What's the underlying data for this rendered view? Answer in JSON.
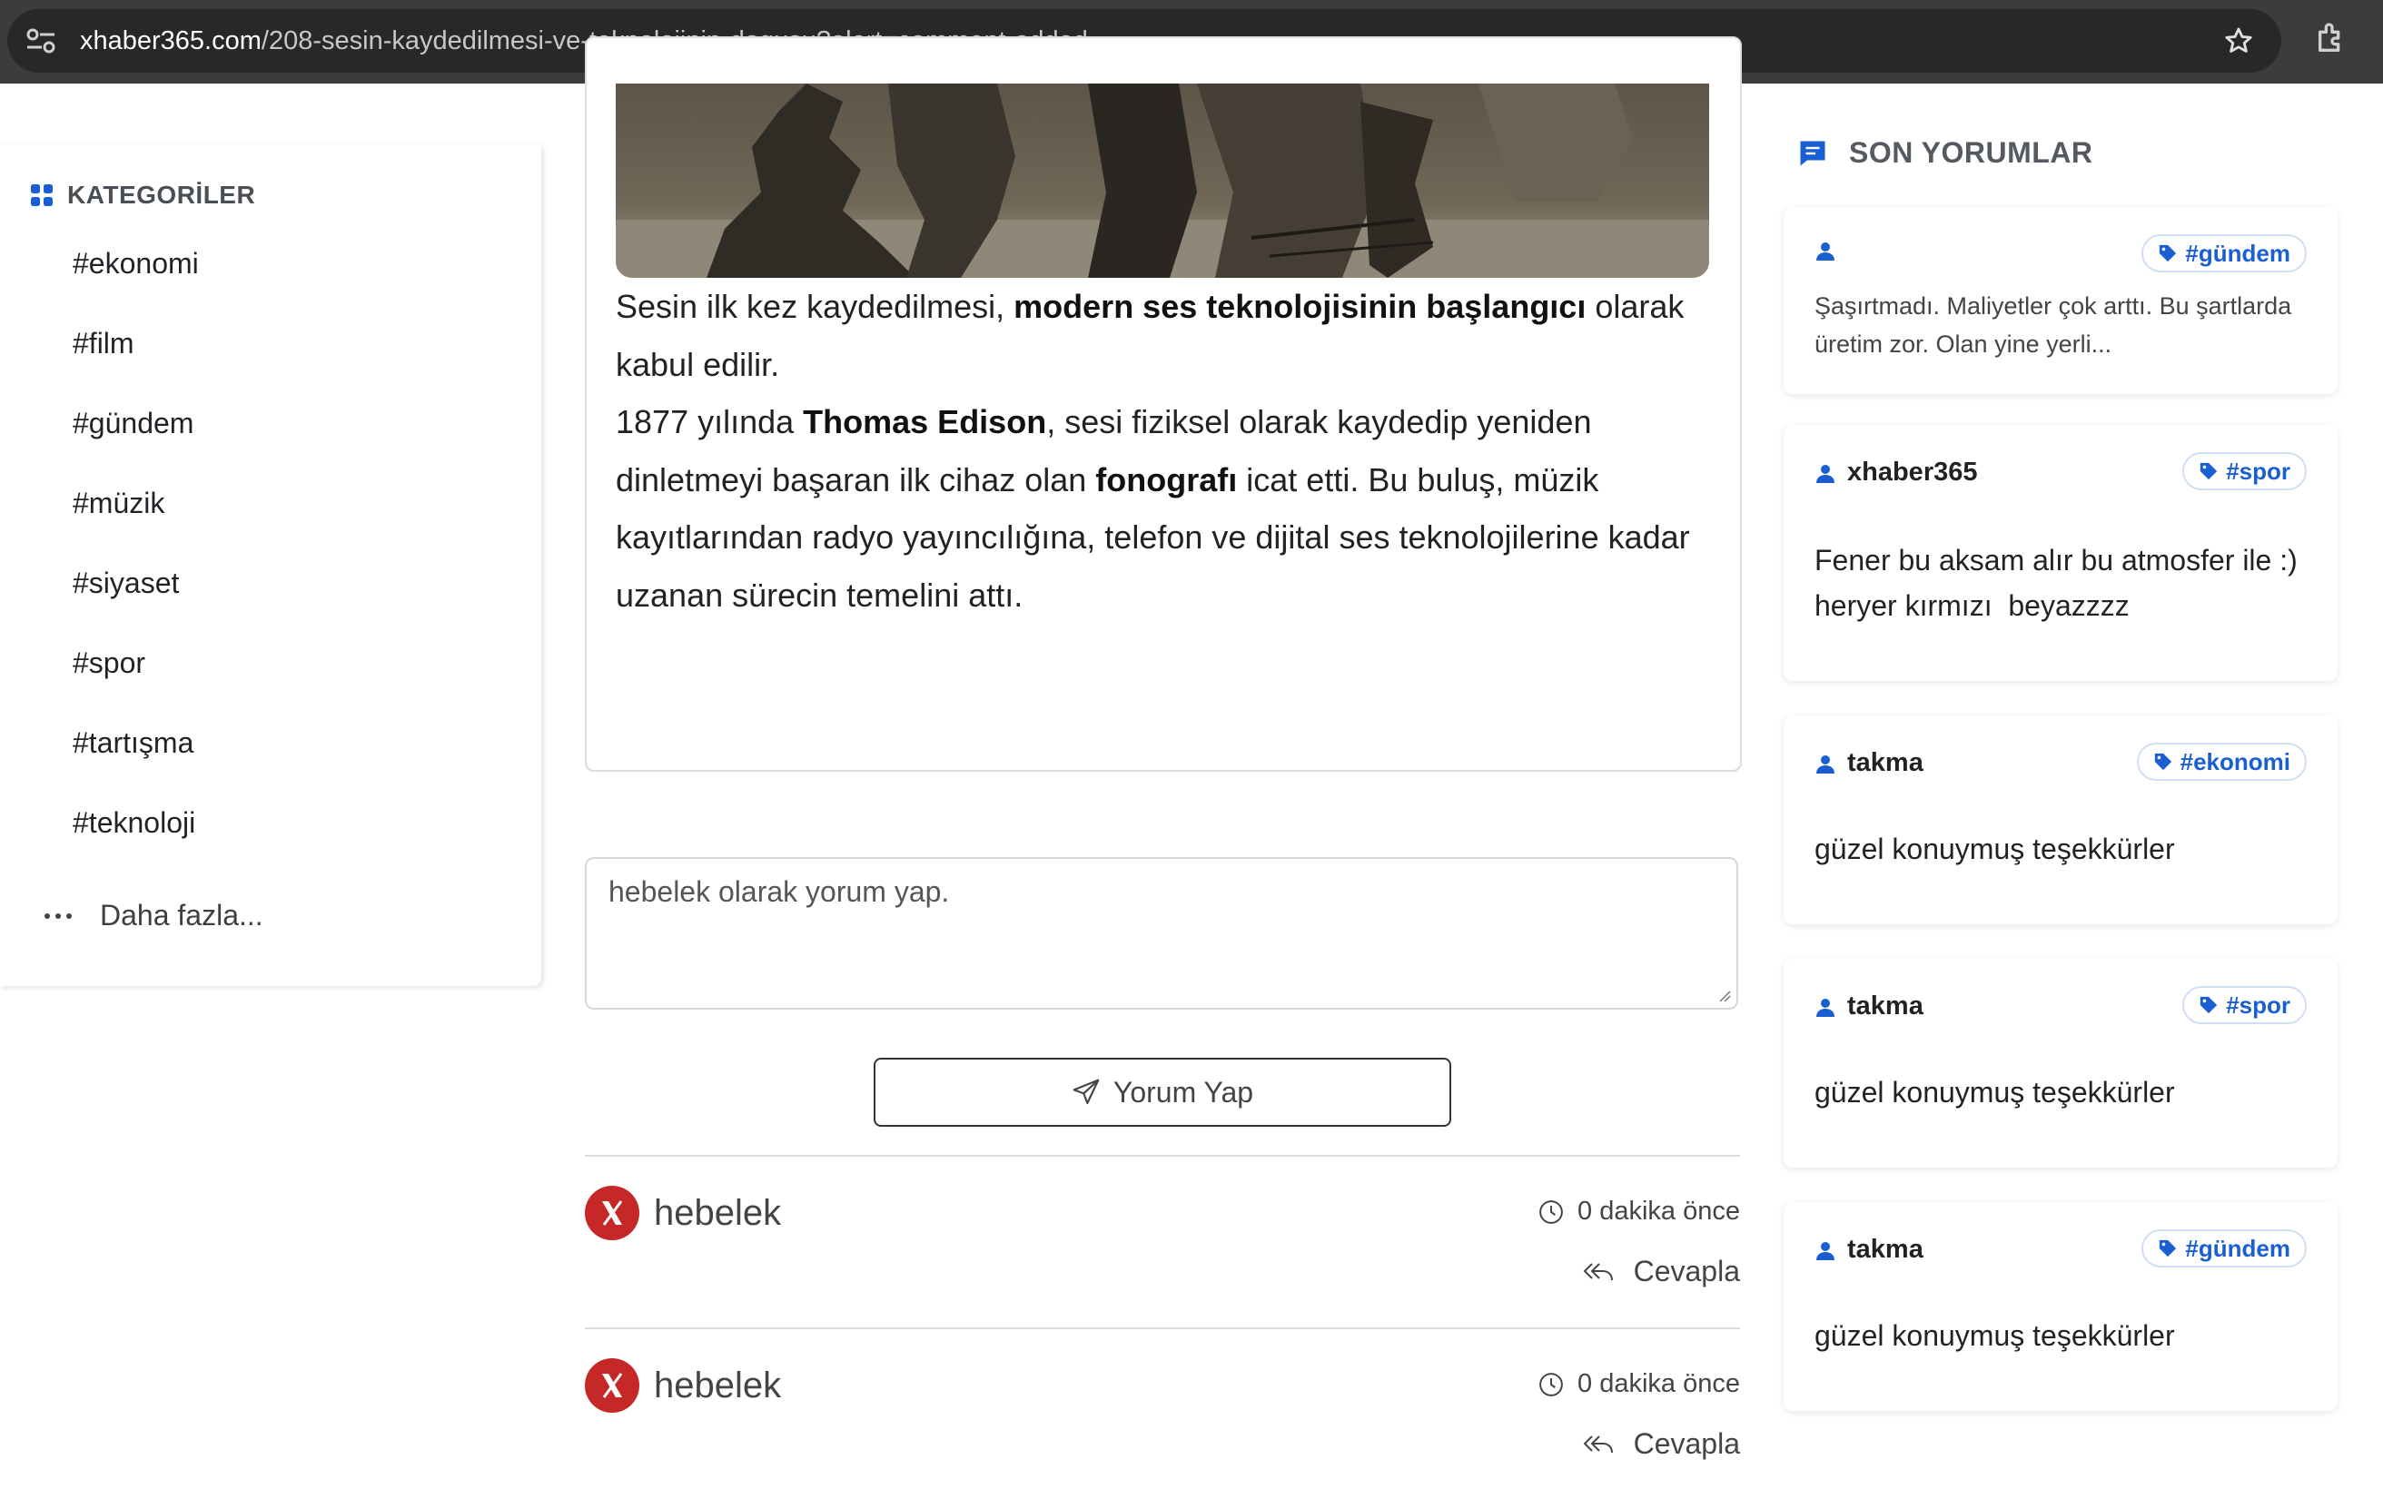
{
  "browser": {
    "url_host": "xhaber365.com",
    "url_path": "/208-sesin-kaydedilmesi-ve-teknolojinin-dogusu?alert=comment-added"
  },
  "sidebar": {
    "title": "KATEGORİLER",
    "categories": [
      "#ekonomi",
      "#film",
      "#gündem",
      "#müzik",
      "#siyaset",
      "#spor",
      "#tartışma",
      "#teknoloji"
    ],
    "more_label": "Daha fazla..."
  },
  "article": {
    "p1_a": "Sesin ilk kez kaydedilmesi, ",
    "p1_b": "modern ses teknolojisinin başlangıcı",
    "p1_c": " olarak kabul edilir.",
    "p2_a": "1877 yılında ",
    "p2_b": "Thomas Edison",
    "p2_c": ", sesi fiziksel olarak kaydedip yeniden dinletmeyi başaran ilk cihaz olan ",
    "p2_d": "fonografı",
    "p2_e": " icat etti. Bu buluş, müzik kayıtlarından radyo yayıncılığına, telefon ve dijital ses teknolojilerine kadar uzanan sürecin temelini attı."
  },
  "comment_form": {
    "placeholder": "hebelek olarak yorum yap.",
    "submit_label": "Yorum Yap"
  },
  "comments": [
    {
      "author": "hebelek",
      "time": "0 dakika önce",
      "reply_label": "Cevapla"
    },
    {
      "author": "hebelek",
      "time": "0 dakika önce",
      "reply_label": "Cevapla"
    }
  ],
  "recent": {
    "title": "SON YORUMLAR",
    "items": [
      {
        "user": "",
        "tag": "#gündem",
        "text": "Şaşırtmadı. Maliyetler çok arttı. Bu şartlarda üretim zor. Olan yine yerli..."
      },
      {
        "user": "xhaber365",
        "tag": "#spor",
        "text": "Fener bu aksam alır bu atmosfer ile :) heryer kırmızı  beyazzzz"
      },
      {
        "user": "takma",
        "tag": "#ekonomi",
        "text": "güzel konuymuş teşekkürler"
      },
      {
        "user": "takma",
        "tag": "#spor",
        "text": "güzel konuymuş teşekkürler"
      },
      {
        "user": "takma",
        "tag": "#gündem",
        "text": "güzel konuymuş teşekkürler"
      }
    ]
  },
  "colors": {
    "accent": "#1a5fd1",
    "x_brand": "#c62828",
    "chrome": "#3c3c3c"
  }
}
